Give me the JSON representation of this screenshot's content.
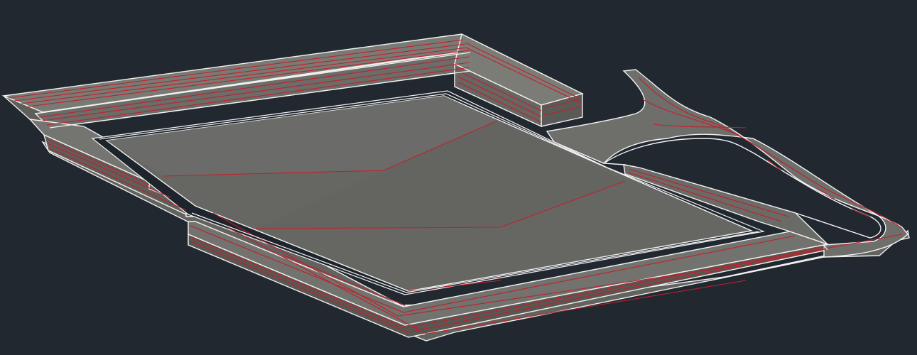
{
  "viewport": {
    "background": "#212830"
  },
  "model": {
    "description_label": "",
    "colors": {
      "face": "#6f6f6b",
      "face_light": "#7c7c77",
      "face_dark": "#5b5b57",
      "slab": "#5d5f5a",
      "edge": "#f2f2f2",
      "contour": "#c2202c"
    }
  }
}
